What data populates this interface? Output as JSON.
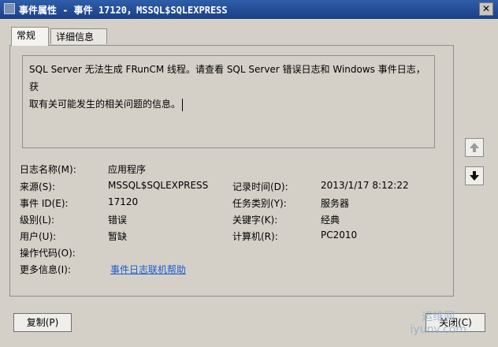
{
  "window": {
    "title": "事件属性 - 事件 17120，MSSQL$SQLEXPRESS",
    "close_label": "✕"
  },
  "tabs": [
    {
      "label": "常规"
    },
    {
      "label": "详细信息"
    }
  ],
  "message": {
    "line1": "SQL Server 无法生成 FRunCM 线程。请查看 SQL Server 错误日志和 Windows 事件日志，获",
    "line2": "取有关可能发生的相关问题的信息。"
  },
  "fields": {
    "log_name": {
      "label": "日志名称(M):",
      "value": "应用程序"
    },
    "source": {
      "label": "来源(S):",
      "value": "MSSQL$SQLEXPRESS"
    },
    "logged": {
      "label": "记录时间(D):",
      "value": "2013/1/17 8:12:22"
    },
    "event_id": {
      "label": "事件 ID(E):",
      "value": "17120"
    },
    "task_category": {
      "label": "任务类别(Y):",
      "value": "服务器"
    },
    "level": {
      "label": "级别(L):",
      "value": "错误"
    },
    "keywords": {
      "label": "关键字(K):",
      "value": "经典"
    },
    "user": {
      "label": "用户(U):",
      "value": "暂缺"
    },
    "computer": {
      "label": "计算机(R):",
      "value": "PC2010"
    },
    "opcode": {
      "label": "操作代码(O):"
    },
    "more_info": {
      "label": "更多信息(I):",
      "link": "事件日志联机帮助"
    }
  },
  "buttons": {
    "copy": "复制(P)",
    "close": "关闭(C)"
  },
  "watermark": "运维网\niyunv.com"
}
